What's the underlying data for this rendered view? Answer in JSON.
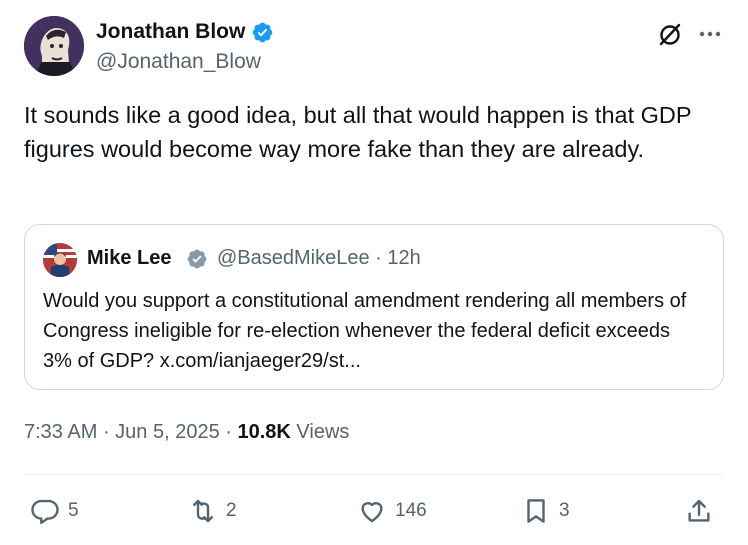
{
  "author": {
    "display_name": "Jonathan Blow",
    "handle": "@Jonathan_Blow",
    "verified": true
  },
  "tweet": {
    "text": "It sounds like a good idea, but all that would happen is that GDP figures would become way more fake than they are already."
  },
  "quoted_tweet": {
    "display_name": "Mike Lee",
    "handle_time": "@BasedMikeLee · 12h",
    "text": "Would you support a constitutional amendment rendering all members of Congress ineligible for re-election whenever the federal deficit exceeds 3% of GDP? x.com/ianjaeger29/st..."
  },
  "meta": {
    "time": "7:33 AM",
    "date": "Jun 5, 2025",
    "views_count": "10.8K",
    "views_label": "Views"
  },
  "actions": {
    "replies": "5",
    "reposts": "2",
    "likes": "146",
    "bookmarks": "3"
  },
  "colors": {
    "verified_blue": "#1d9bf0",
    "secondary_text": "#536471",
    "primary_text": "#0f1419",
    "border": "#cfd9de"
  },
  "icons": [
    "grok-icon",
    "more-icon",
    "reply-icon",
    "repost-icon",
    "like-icon",
    "bookmark-icon",
    "share-icon",
    "verified-badge-icon"
  ]
}
